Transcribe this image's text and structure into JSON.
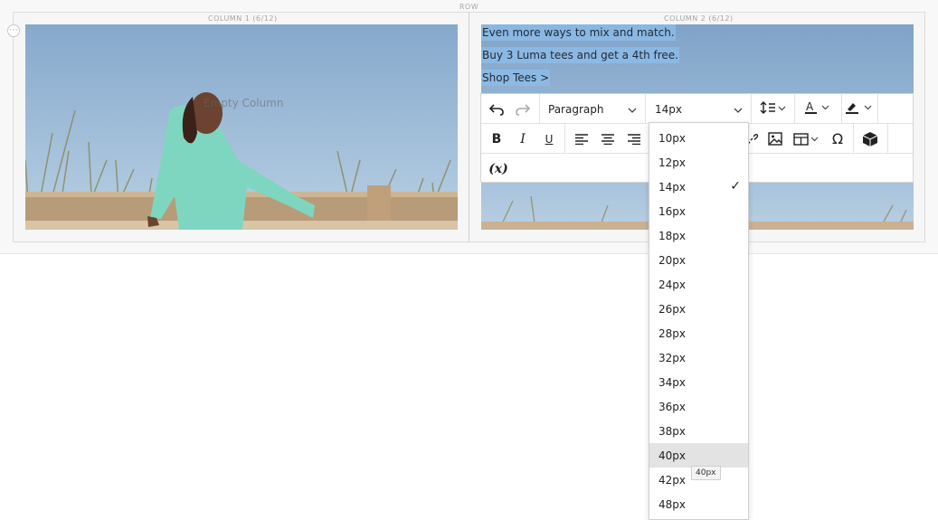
{
  "row": {
    "label": "ROW"
  },
  "columns": [
    {
      "label": "COLUMN 1 (6/12)",
      "empty_text": "Empty Column"
    },
    {
      "label": "COLUMN 2 (6/12)"
    }
  ],
  "content": {
    "lines": [
      "Even more ways to mix and match.",
      "Buy 3 Luma tees and get a 4th free.",
      "Shop Tees >"
    ]
  },
  "toolbar": {
    "block_format": "Paragraph",
    "font_size": "14px",
    "icons_row1": [
      "undo-icon",
      "redo-icon",
      "line-height-icon",
      "text-color-icon",
      "highlight-color-icon"
    ],
    "icons_row2": [
      "bold-icon",
      "italic-icon",
      "underline-icon",
      "align-left-icon",
      "align-center-icon",
      "align-right-icon",
      "link-icon",
      "image-icon",
      "table-icon",
      "special-char-icon",
      "widget-icon"
    ],
    "variable_label": "(x)"
  },
  "font_size_menu": {
    "options": [
      "10px",
      "12px",
      "14px",
      "16px",
      "18px",
      "20px",
      "24px",
      "26px",
      "28px",
      "32px",
      "34px",
      "36px",
      "38px",
      "40px",
      "42px",
      "48px"
    ],
    "selected": "14px",
    "hovered": "40px"
  },
  "tooltip": {
    "text": "40px"
  }
}
